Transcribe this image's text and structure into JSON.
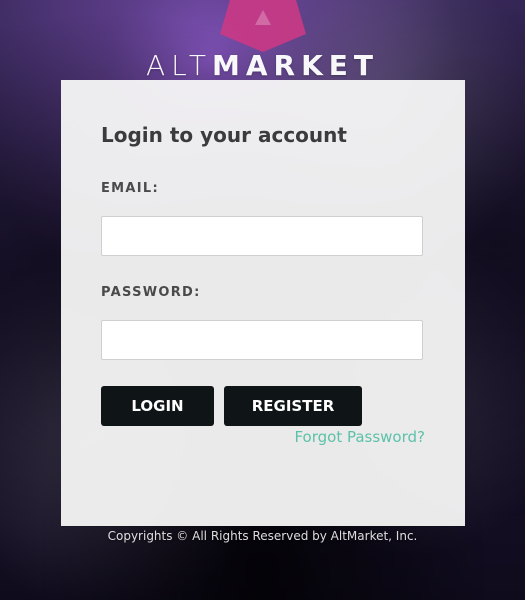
{
  "brand": {
    "text_light": "ALT",
    "text_bold": "MARKET",
    "mark_color": "#c63a86"
  },
  "login": {
    "title": "Login to your account",
    "email_label": "EMAIL:",
    "email_value": "",
    "email_placeholder": "",
    "password_label": "PASSWORD:",
    "password_value": "",
    "password_placeholder": "",
    "login_button": "LOGIN",
    "register_button": "REGISTER",
    "forgot_password": "Forgot Password?",
    "forgot_color": "#5cc1a8"
  },
  "footer": {
    "copyright": "Copyrights © All Rights Reserved by AltMarket, Inc."
  }
}
